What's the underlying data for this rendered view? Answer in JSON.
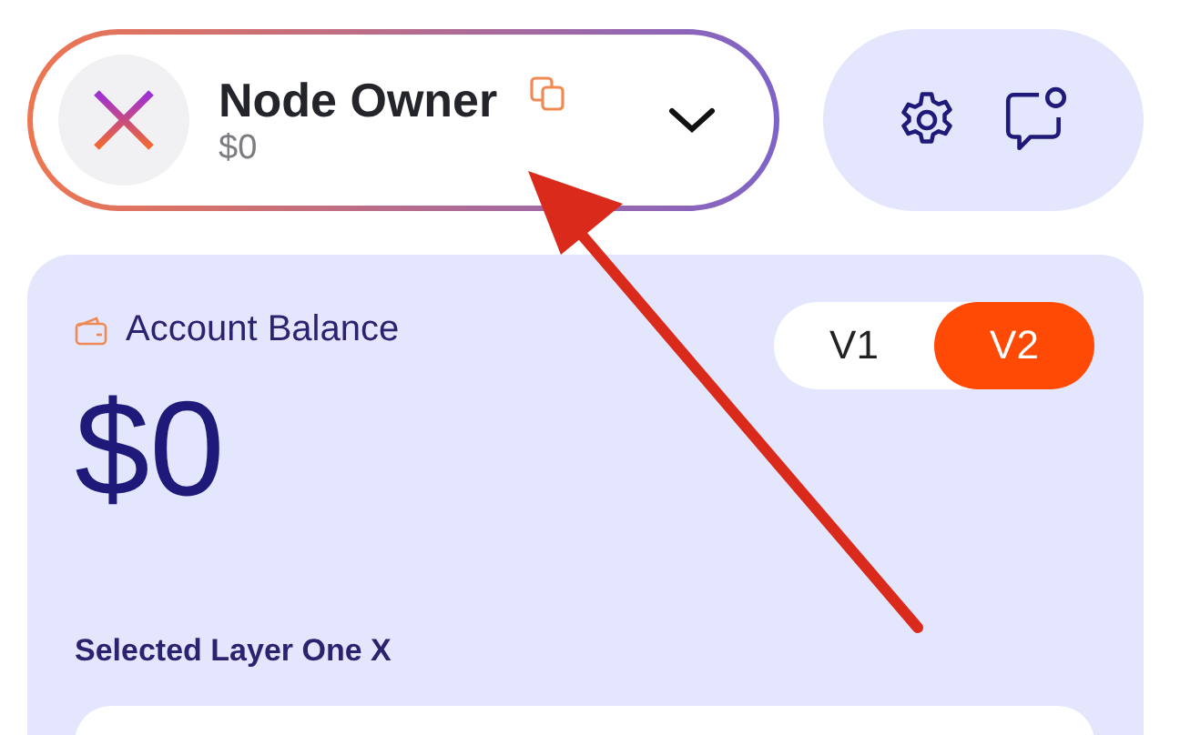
{
  "account": {
    "name": "Node Owner",
    "balance": "$0"
  },
  "balance_card": {
    "label": "Account Balance",
    "amount": "$0",
    "versions": [
      {
        "label": "V1",
        "selected": false
      },
      {
        "label": "V2",
        "selected": true
      }
    ],
    "section_title": "Selected Layer One X"
  }
}
